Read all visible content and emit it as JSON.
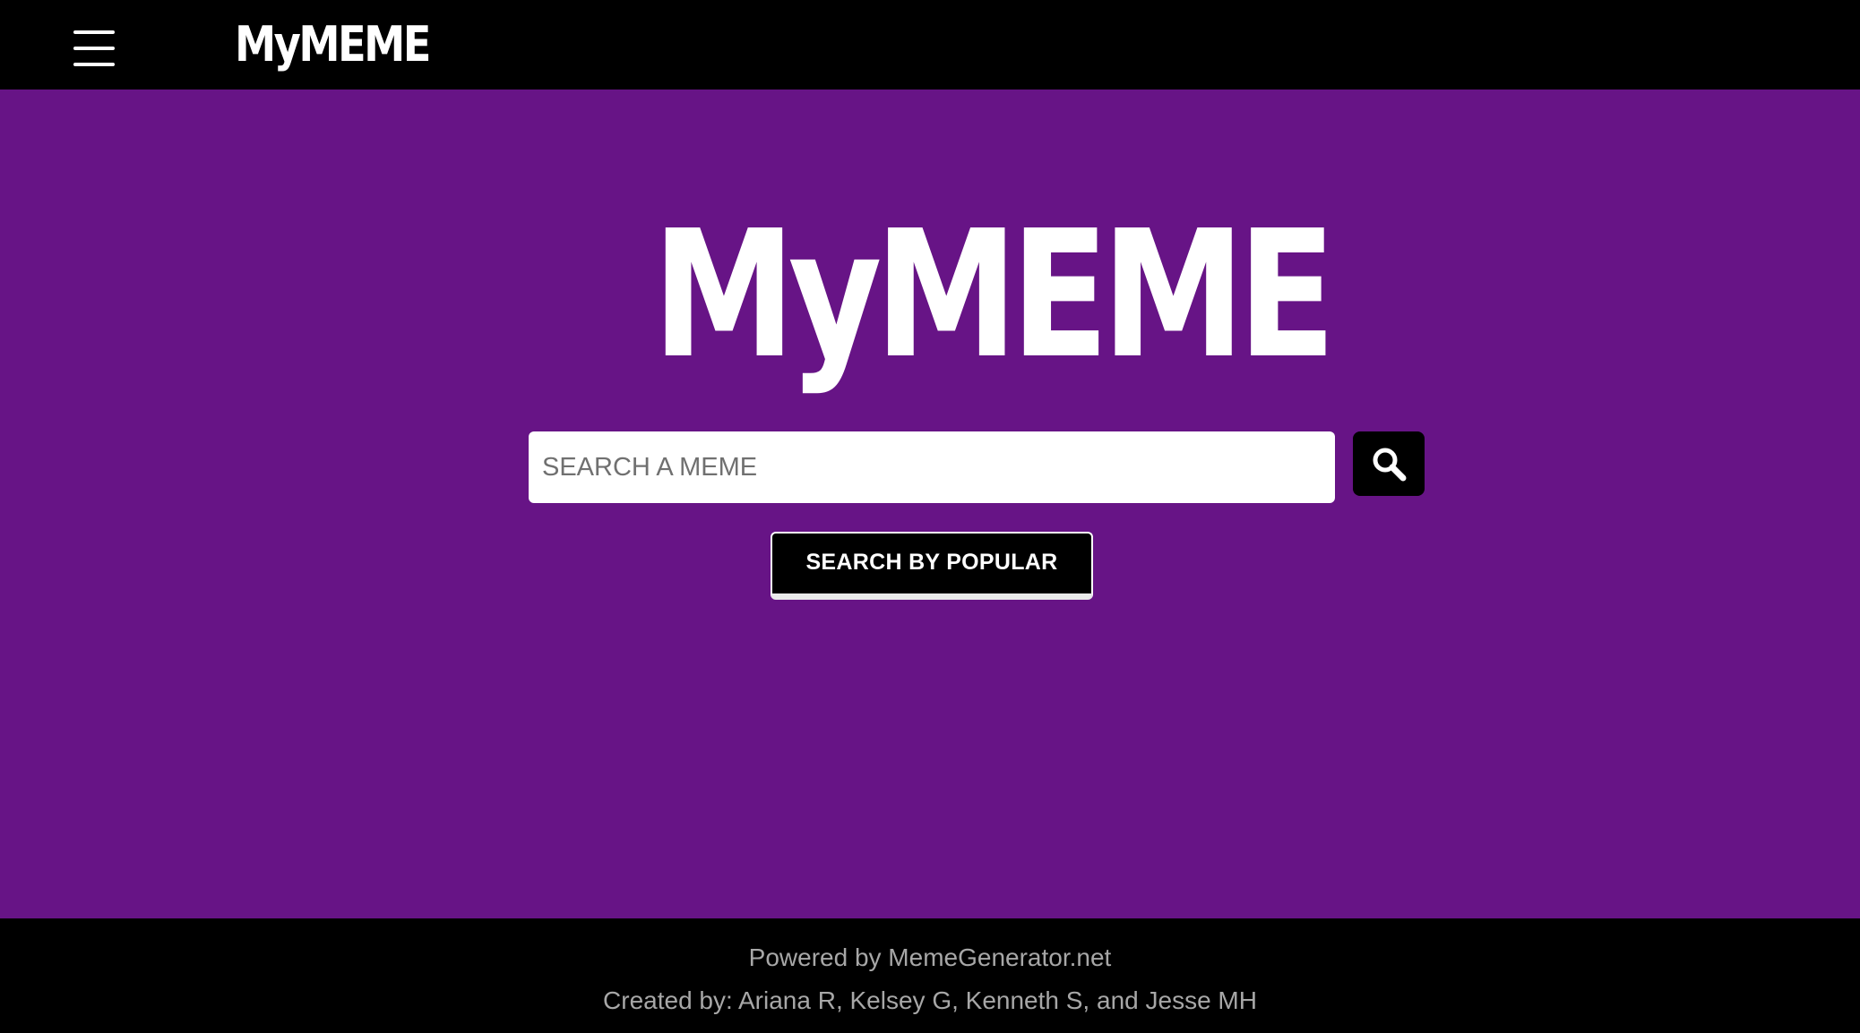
{
  "navbar": {
    "menu_icon": "hamburger-menu-icon",
    "logo": "MyMEME"
  },
  "hero": {
    "logo": "MyMEME"
  },
  "search": {
    "placeholder": "SEARCH A MEME",
    "value": "",
    "button_icon": "search-icon"
  },
  "popular_button": {
    "label": "SEARCH BY POPULAR"
  },
  "footer": {
    "powered_by": "Powered by MemeGenerator.net",
    "created_by": "Created by: Ariana R, Kelsey G, Kenneth S, and Jesse MH"
  },
  "colors": {
    "main_background": "#671486",
    "header_background": "#000000",
    "footer_background": "#000000",
    "footer_text": "#a7a7a7",
    "logo_text": "#ffffff"
  }
}
